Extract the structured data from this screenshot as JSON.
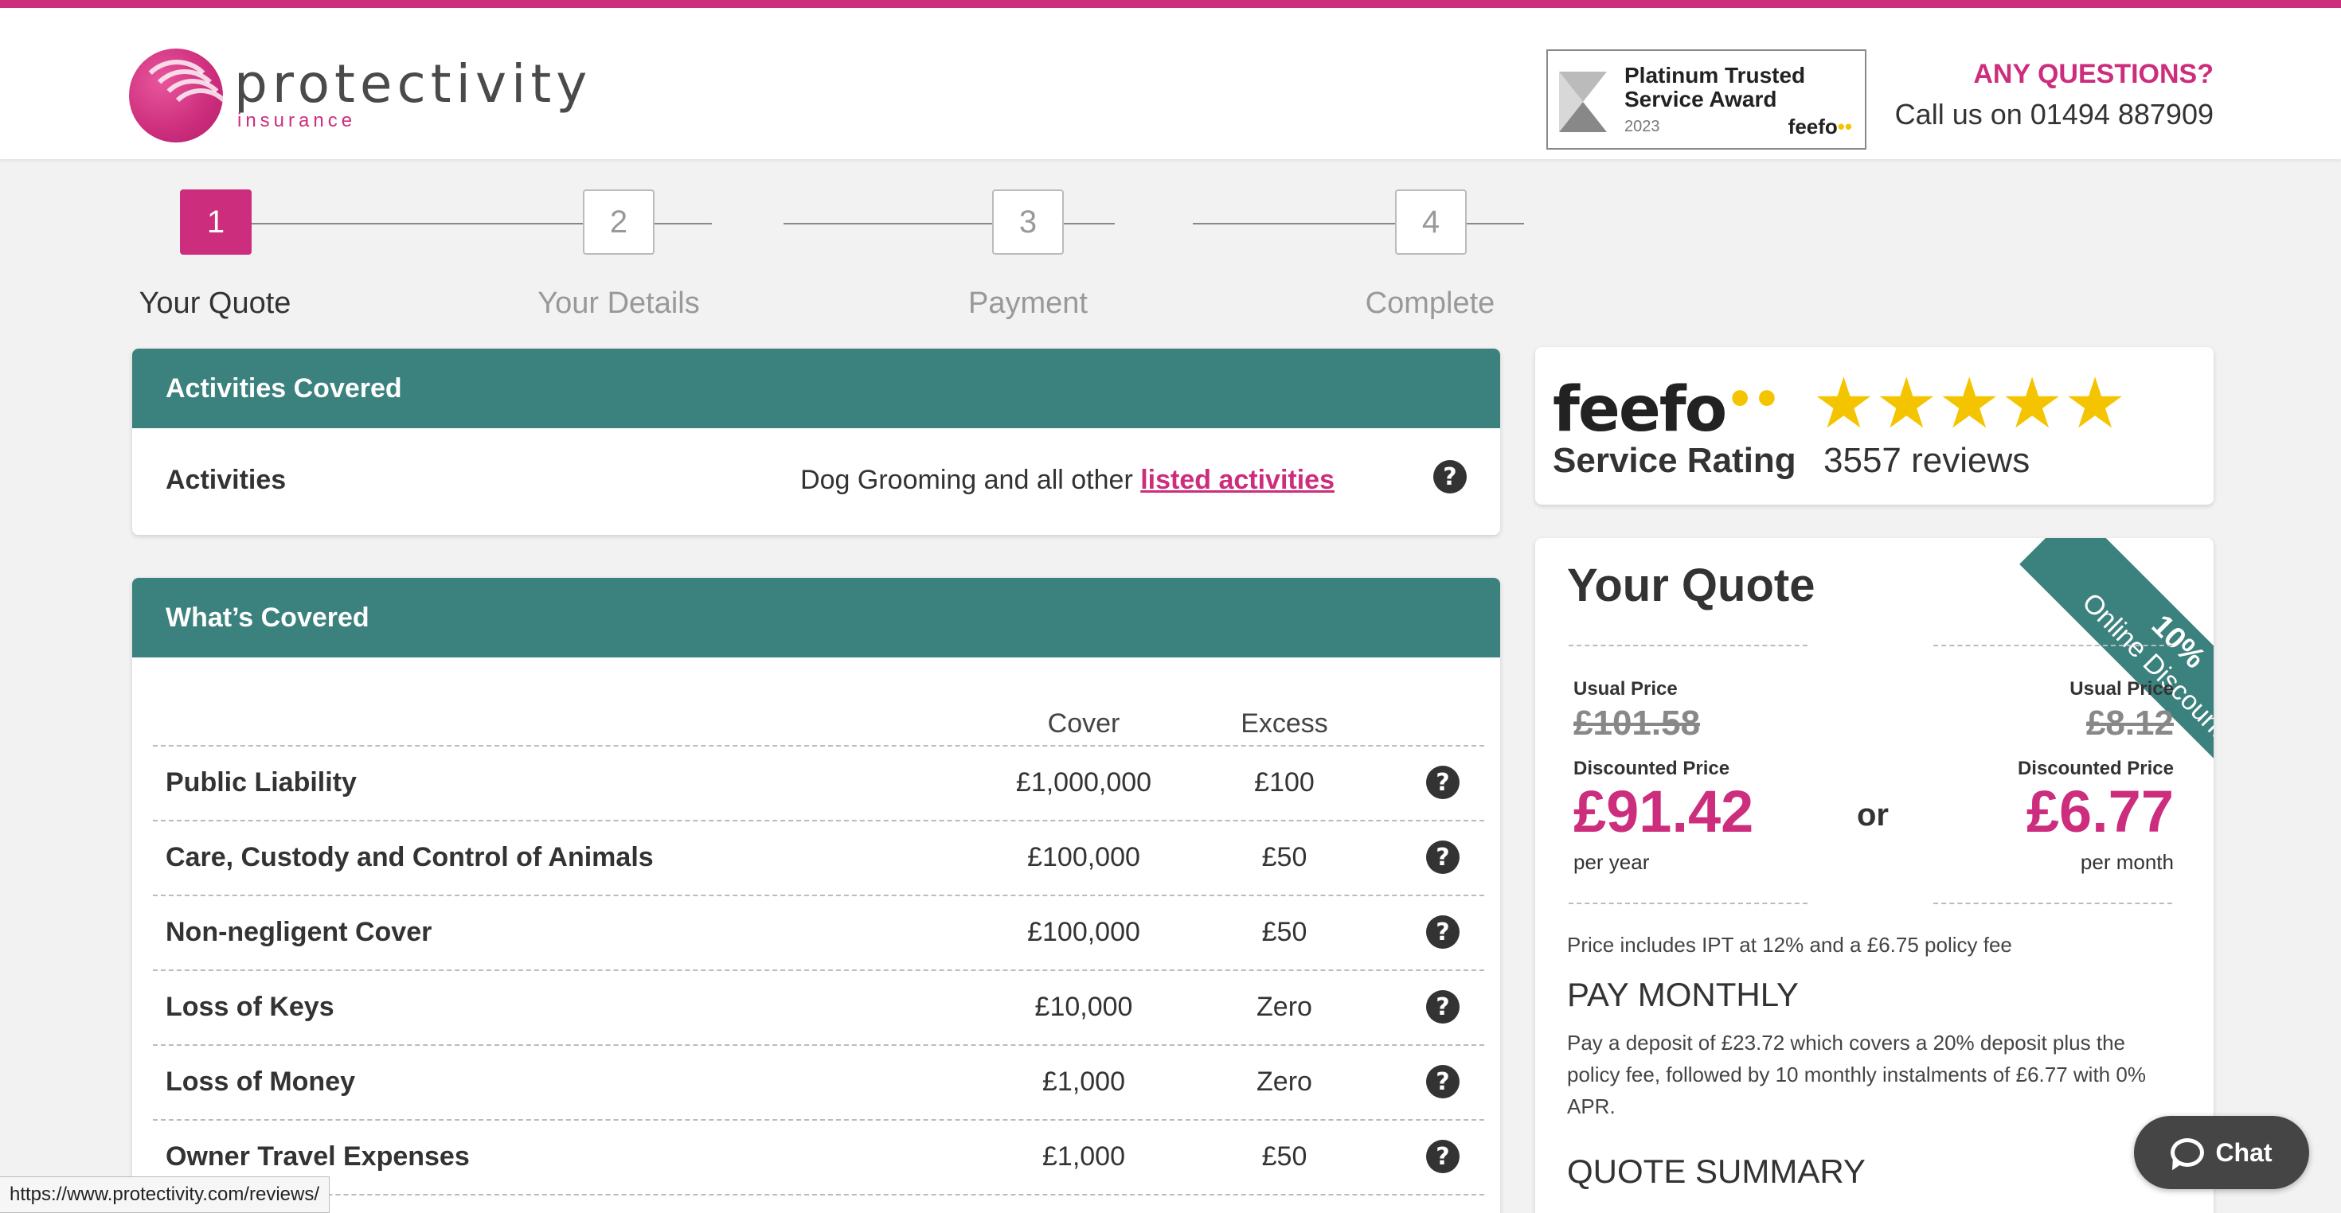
{
  "header": {
    "logo_name": "protectivity",
    "logo_sub": "insurance",
    "award": {
      "title_line1": "Platinum Trusted",
      "title_line2": "Service Award",
      "year": "2023",
      "brand": "feefo"
    },
    "questions_title": "ANY QUESTIONS?",
    "phone_text": "Call us on 01494 887909"
  },
  "steps": [
    {
      "number": "1",
      "label": "Your Quote",
      "active": true
    },
    {
      "number": "2",
      "label": "Your Details",
      "active": false
    },
    {
      "number": "3",
      "label": "Payment",
      "active": false
    },
    {
      "number": "4",
      "label": "Complete",
      "active": false
    }
  ],
  "activities": {
    "heading": "Activities Covered",
    "label": "Activities",
    "value_prefix": "Dog Grooming and all other ",
    "link_text": "listed activities"
  },
  "coverage": {
    "heading": "What’s Covered",
    "col_cover": "Cover",
    "col_excess": "Excess",
    "rows": [
      {
        "name": "Public Liability",
        "cover": "£1,000,000",
        "excess": "£100"
      },
      {
        "name": "Care, Custody and Control of Animals",
        "cover": "£100,000",
        "excess": "£50"
      },
      {
        "name": "Non-negligent Cover",
        "cover": "£100,000",
        "excess": "£50"
      },
      {
        "name": "Loss of Keys",
        "cover": "£10,000",
        "excess": "Zero"
      },
      {
        "name": "Loss of Money",
        "cover": "£1,000",
        "excess": "Zero"
      },
      {
        "name": "Owner Travel Expenses",
        "cover": "£1,000",
        "excess": "£50"
      }
    ]
  },
  "feefo": {
    "logo": "feefo",
    "label": "Service Rating",
    "reviews": "3557 reviews",
    "stars": 5
  },
  "quote": {
    "title": "Your Quote",
    "ribbon_line1": "10%",
    "ribbon_line2": "Online Discount",
    "usual_label": "Usual Price",
    "discounted_label": "Discounted Price",
    "yearly": {
      "usual": "£101.58",
      "discounted": "£91.42",
      "per": "per year"
    },
    "monthly": {
      "usual": "£8.12",
      "discounted": "£6.77",
      "per": "per month"
    },
    "or_text": "or",
    "ipt_text": "Price includes IPT at 12% and a £6.75 policy fee",
    "pay_monthly_title": "PAY MONTHLY",
    "pay_monthly_text": "Pay a deposit of £23.72 which covers a 20% deposit plus the policy fee, followed by 10 monthly instalments of £6.77 with 0% APR.",
    "summary_title": "QUOTE SUMMARY"
  },
  "chat": {
    "label": "Chat"
  },
  "status_url": "https://www.protectivity.com/reviews/",
  "colors": {
    "brand_pink": "#cc2d7c",
    "teal": "#3b817e",
    "star": "#f5c400"
  }
}
